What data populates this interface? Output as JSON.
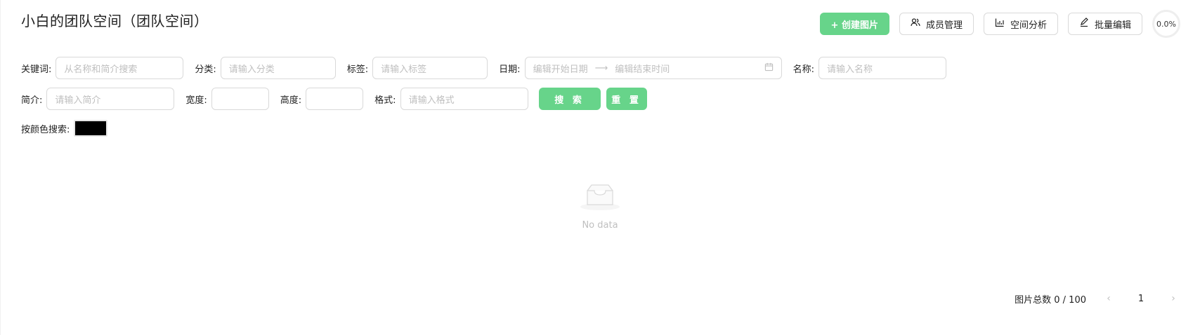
{
  "header": {
    "title": "小白的团队空间（团队空间）",
    "create_label": "+ 创建图片",
    "members_label": "成员管理",
    "analysis_label": "空间分析",
    "batch_edit_label": "批量编辑",
    "usage_percent": "0.0%"
  },
  "search": {
    "keyword_label": "关键词:",
    "keyword_placeholder": "从名称和简介搜索",
    "category_label": "分类:",
    "category_placeholder": "请输入分类",
    "tag_label": "标签:",
    "tag_placeholder": "请输入标签",
    "date_label": "日期:",
    "date_start_placeholder": "编辑开始日期",
    "date_end_placeholder": "编辑结束时间",
    "name_label": "名称:",
    "name_placeholder": "请输入名称",
    "intro_label": "简介:",
    "intro_placeholder": "请输入简介",
    "width_label": "宽度:",
    "height_label": "高度:",
    "format_label": "格式:",
    "format_placeholder": "请输入格式",
    "search_button": "搜 索",
    "reset_button": "重 置",
    "color_label": "按颜色搜索:",
    "color_value": "#000000"
  },
  "empty": {
    "text": "No data"
  },
  "pagination": {
    "total_text": "图片总数 0 / 100",
    "current_page": "1"
  },
  "colors": {
    "primary": "#67d48a",
    "border": "#d9d9d9",
    "placeholder": "#bfbfbf"
  }
}
